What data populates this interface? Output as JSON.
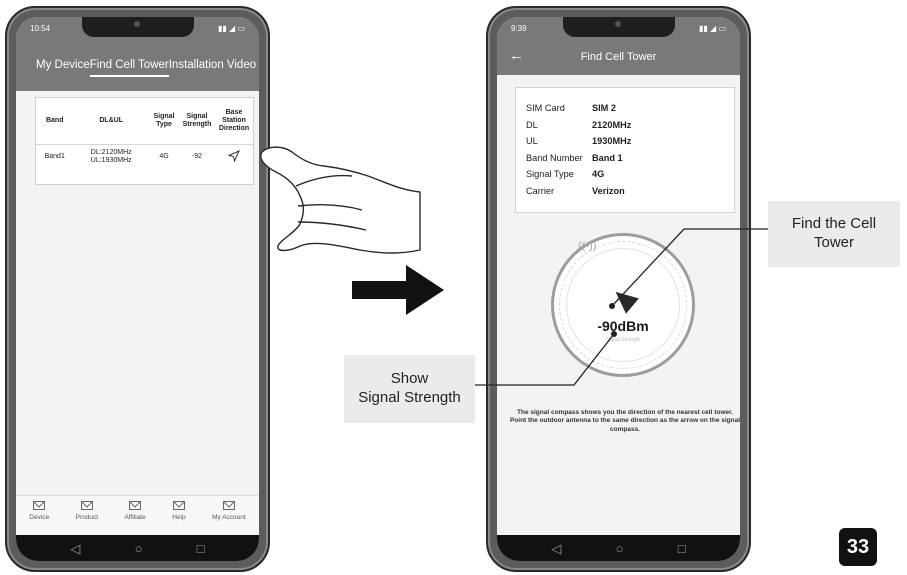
{
  "left_phone": {
    "status_time": "10:54",
    "tabs": [
      "My Device",
      "Find Cell Tower",
      "Installation Video"
    ],
    "active_tab": "Find Cell Tower",
    "table": {
      "headers": [
        "Band",
        "DL&UL",
        "Signal Type",
        "Signal Strength",
        "Base Station Direction"
      ],
      "row": {
        "band": "Band1",
        "dl": "DL:2120MHz",
        "ul": "UL:1930MHz",
        "type": "4G",
        "strength": "-92"
      }
    },
    "bottom_tabs": [
      "Device",
      "Product",
      "Affiliate",
      "Help",
      "My Account"
    ]
  },
  "right_phone": {
    "status_time": "9:39",
    "title": "Find Cell Tower",
    "info": [
      {
        "label": "SIM Card",
        "value": "SIM 2"
      },
      {
        "label": "DL",
        "value": "2120MHz"
      },
      {
        "label": "UL",
        "value": "1930MHz"
      },
      {
        "label": "Band Number",
        "value": "Band 1"
      },
      {
        "label": "Signal Type",
        "value": "4G"
      },
      {
        "label": "Carrier",
        "value": "Verizon"
      }
    ],
    "signal_value": "-90dBm",
    "signal_sub": "Signal Strength",
    "description_1": "The signal compass shows you the direction of the nearest cell tower.",
    "description_2": "Point the outdoor antenna to the same direction as the arrow on the signal compass."
  },
  "callouts": {
    "tower_line1": "Find the Cell",
    "tower_line2": "Tower",
    "signal_line1": "Show",
    "signal_line2": "Signal Strength"
  },
  "page_number": "33",
  "colors": {
    "header": "#797979",
    "callout_bg": "#ebebeb",
    "frame": "#5c5c5c"
  },
  "icons": {
    "back": "back-arrow-icon",
    "direction": "navigation-arrow-icon",
    "tower": "cell-tower-icon",
    "tab": "mail-icon"
  }
}
